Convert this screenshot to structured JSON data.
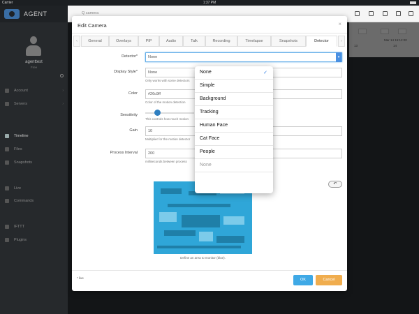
{
  "status_bar": {
    "carrier": "Carrier",
    "time": "1:37 PM"
  },
  "sidebar": {
    "app_name": "AGENT",
    "user": {
      "name": "agenttest",
      "role": "Free"
    },
    "items": [
      {
        "label": "Account",
        "chevron": "›"
      },
      {
        "label": "Servers",
        "chevron": "›"
      },
      {
        "label": "Timeline"
      },
      {
        "label": "Files"
      },
      {
        "label": "Snapshots"
      },
      {
        "label": "Live"
      },
      {
        "label": "Commands"
      },
      {
        "label": "IFTTT"
      },
      {
        "label": "Plugins"
      }
    ]
  },
  "topbar": {
    "search_text": "Q camera"
  },
  "timeline": {
    "date": "Mar 14 15:12:20",
    "ticks": [
      "13",
      "14"
    ]
  },
  "modal": {
    "title": "Edit Camera",
    "close": "×",
    "tab_prev": "‹",
    "tab_next": "›",
    "tabs": [
      {
        "label": "General"
      },
      {
        "label": "Overlays"
      },
      {
        "label": "PIP"
      },
      {
        "label": "Audio"
      },
      {
        "label": "Talk"
      },
      {
        "label": "Recording"
      },
      {
        "label": "Timelapse"
      },
      {
        "label": "Snapshots"
      },
      {
        "label": "Detector",
        "active": true
      }
    ],
    "form": {
      "detector": {
        "label": "Detector*",
        "value": "None"
      },
      "display_style": {
        "label": "Display Style*",
        "value": "None",
        "help": "Only works with some detectors"
      },
      "color": {
        "label": "Color",
        "value": "#26c9ff",
        "help": "Color of the motion detection"
      },
      "sensitivity": {
        "label": "Sensitivity",
        "help": "This controls how much motion",
        "value_fraction": 0.2
      },
      "gain": {
        "label": "Gain",
        "value": "10",
        "help": "Multiplier for the motion detector"
      },
      "process_interval": {
        "label": "Process Interval",
        "value": "200",
        "help": "milliseconds between process"
      }
    },
    "undo_glyph": "↶",
    "preview_caption": "Define an area to monitor (blue).",
    "live_note": "* live",
    "ok_label": "OK",
    "cancel_label": "Cancel"
  },
  "dropdown": {
    "check": "✓",
    "options": [
      {
        "label": "None",
        "selected": true
      },
      {
        "label": "Simple"
      },
      {
        "label": "Background"
      },
      {
        "label": "Tracking"
      },
      {
        "label": "Human Face"
      },
      {
        "label": "Cat Face"
      },
      {
        "label": "People"
      },
      {
        "label": "None",
        "disabled": true
      }
    ]
  },
  "colors": {
    "accent": "#3fa9e6",
    "warning": "#f0ad4e",
    "preview": "#2fa6d8"
  }
}
